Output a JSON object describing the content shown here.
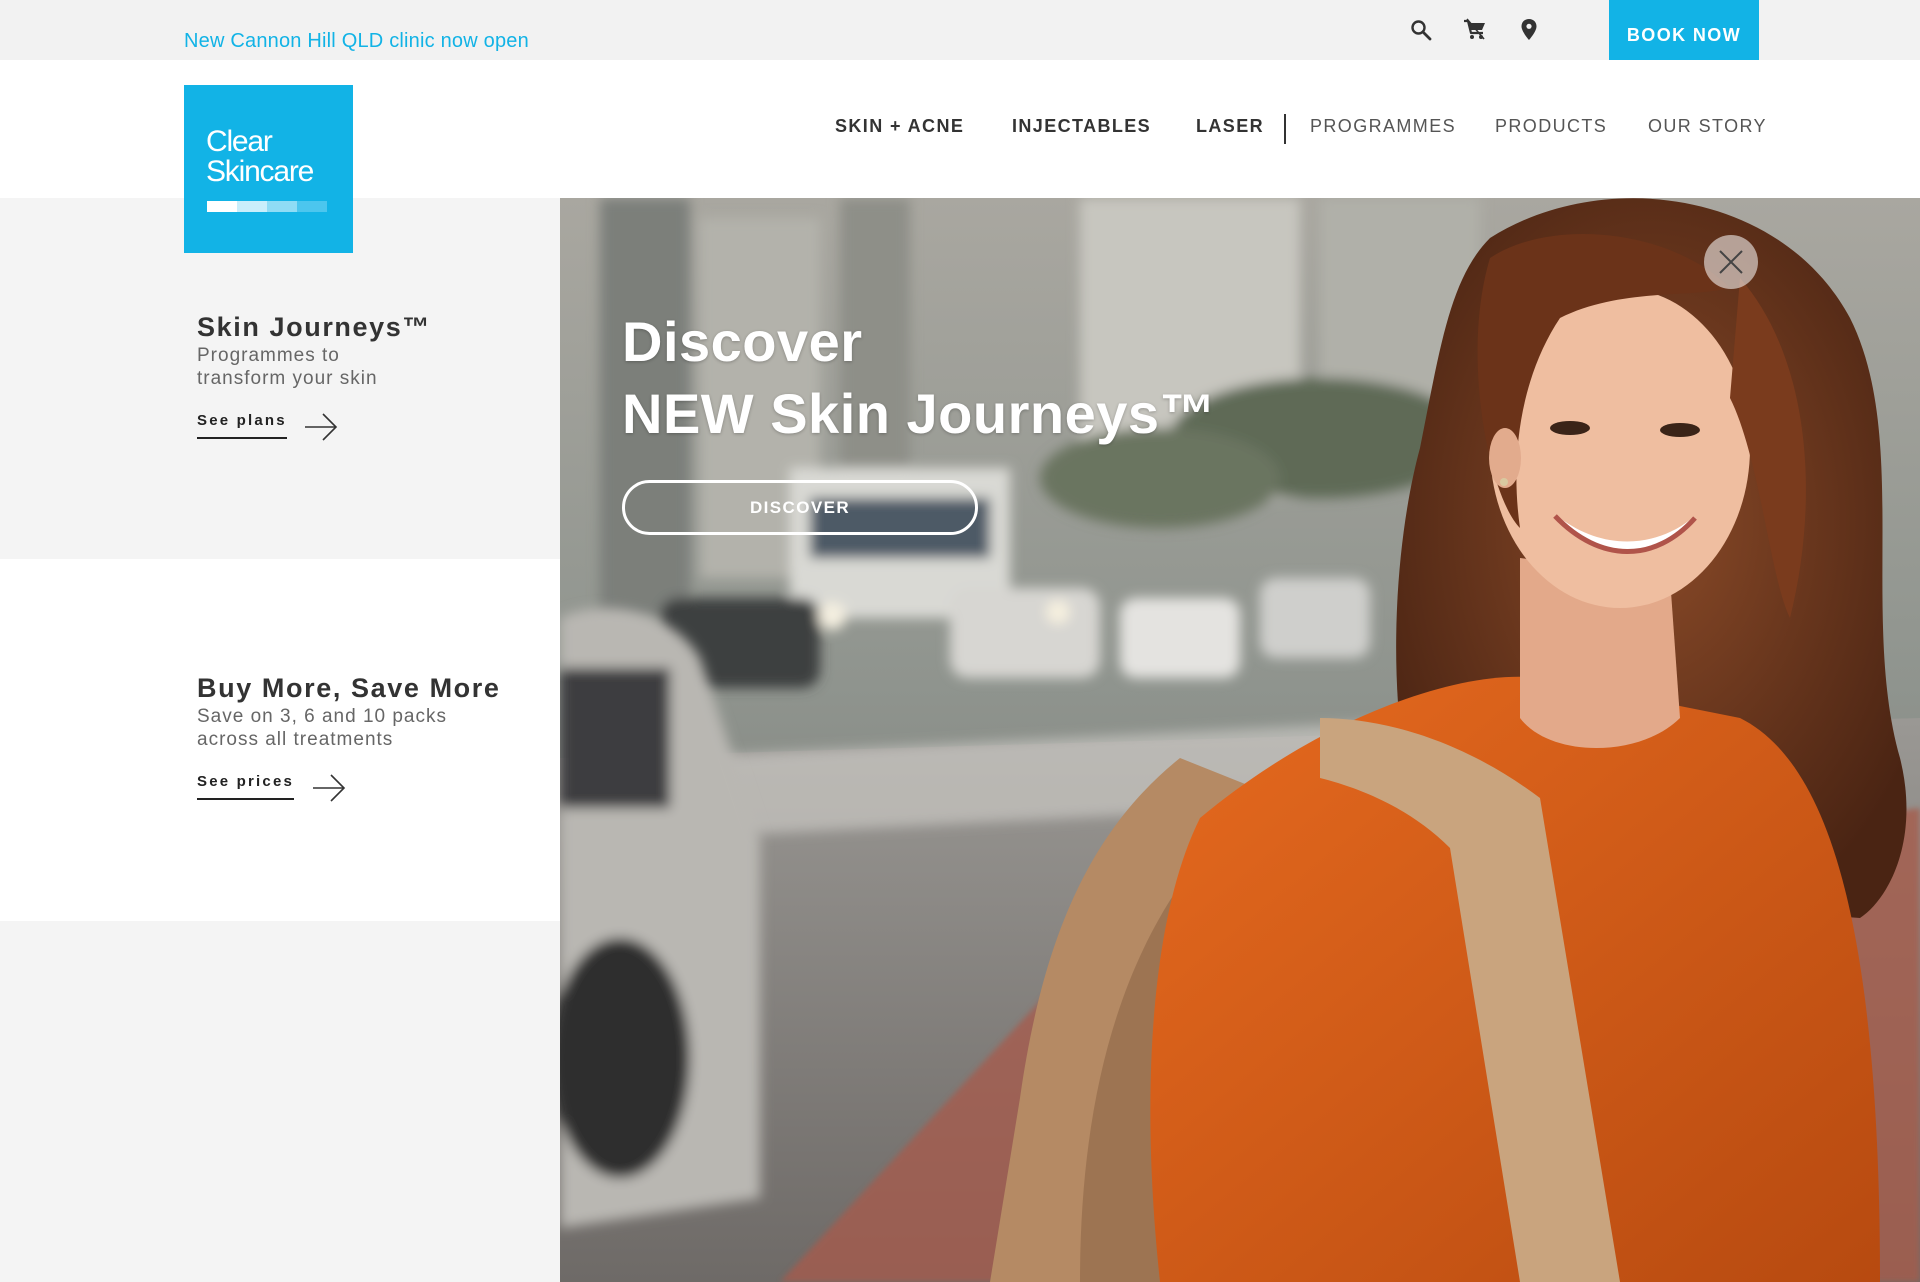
{
  "topbar": {
    "announcement": "New Cannon Hill QLD clinic now open",
    "icons": [
      "search-icon",
      "cart-icon",
      "location-pin-icon"
    ],
    "book_now": "BOOK NOW"
  },
  "brand": {
    "line1": "Clear",
    "line2": "Skincare",
    "color": "#12b3e6",
    "bar_colors": [
      "#ffffff",
      "#c9eefb",
      "#8fdcf5",
      "#4cc6ee"
    ]
  },
  "nav": {
    "items": [
      {
        "label": "SKIN + ACNE",
        "weight": "bold"
      },
      {
        "label": "INJECTABLES",
        "weight": "bold"
      },
      {
        "label": "LASER",
        "weight": "bold"
      },
      {
        "label": "PROGRAMMES",
        "weight": "light"
      },
      {
        "label": "PRODUCTS",
        "weight": "light"
      },
      {
        "label": "OUR STORY",
        "weight": "light"
      }
    ]
  },
  "promos": [
    {
      "title": "Skin Journeys™",
      "subtitle_line1": "Programmes to",
      "subtitle_line2": "transform your skin",
      "link": "See plans"
    },
    {
      "title": "Buy More, Save More",
      "subtitle_line1": "Save on 3, 6 and 10 packs",
      "subtitle_line2": "across all treatments",
      "link": "See prices"
    }
  ],
  "hero": {
    "title_line1": "Discover",
    "title_line2": "NEW Skin Journeys™",
    "button": "DISCOVER"
  }
}
